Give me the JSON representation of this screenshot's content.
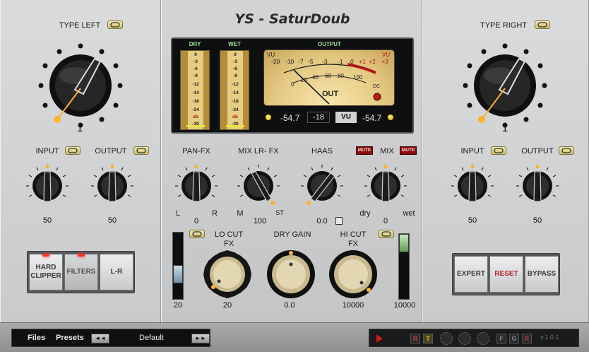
{
  "app": {
    "title": "YS - SaturDoub",
    "version": "v.1.0.1"
  },
  "left": {
    "type_label": "TYPE LEFT",
    "type_value": "1",
    "input_label": "INPUT",
    "input_value": "50",
    "output_label": "OUTPUT",
    "output_value": "50",
    "buttons": [
      "HARD CLIPPER",
      "FILTERS",
      "L-R"
    ]
  },
  "right": {
    "type_label": "TYPE RIGHT",
    "type_value": "1",
    "input_label": "INPUT",
    "input_value": "50",
    "output_label": "OUTPUT",
    "output_value": "50",
    "buttons": [
      "EXPERT",
      "RESET",
      "BYPASS"
    ]
  },
  "meters": {
    "dry_label": "DRY",
    "wet_label": "WET",
    "output_label": "OUTPUT",
    "strip_ticks": [
      "0",
      "-3",
      "-6",
      "-9",
      "-12",
      "-14",
      "-18",
      "-24",
      "db",
      "-30"
    ],
    "vu_scale": [
      "-20",
      "-10",
      "-7",
      "-5",
      "-3",
      "-1",
      "0",
      "+1",
      "+2",
      "+3"
    ],
    "vu_inner": [
      "0",
      "20",
      "40",
      "60",
      "80",
      "100"
    ],
    "vu_left": "VU",
    "vu_right": "VU",
    "vu_out": "OUT",
    "vu_dc": "DC",
    "readout_left": "-54.7",
    "readout_mid": "-18",
    "readout_mode": "VU",
    "readout_right": "-54.7"
  },
  "center": {
    "panfx_label": "PAN-FX",
    "panfx_value": "0",
    "panfx_l": "L",
    "panfx_r": "R",
    "mix_lr_label": "MIX LR- FX",
    "mix_lr_value": "100",
    "mix_lr_m": "M",
    "mix_lr_st": "ST",
    "haas_label": "HAAS",
    "haas_value": "0.0",
    "mix_label": "MIX",
    "mix_value": "0",
    "mix_dry": "dry",
    "mix_wet": "wet",
    "mute_label": "MUTE",
    "locut_label": "LO CUT\nFX",
    "locut_value": "20",
    "drygain_label": "DRY GAIN",
    "drygain_value": "0.0",
    "hicut_label": "HI CUT\nFX",
    "hicut_value": "10000",
    "fader_left_value": "20",
    "fader_right_value": "10000"
  },
  "footer": {
    "files_label": "Files",
    "presets_label": "Presets",
    "prev_label": "◄◄",
    "next_label": "►►",
    "preset_name": "Default",
    "status_letters": [
      "R",
      "T",
      "F",
      "G",
      "R"
    ]
  }
}
